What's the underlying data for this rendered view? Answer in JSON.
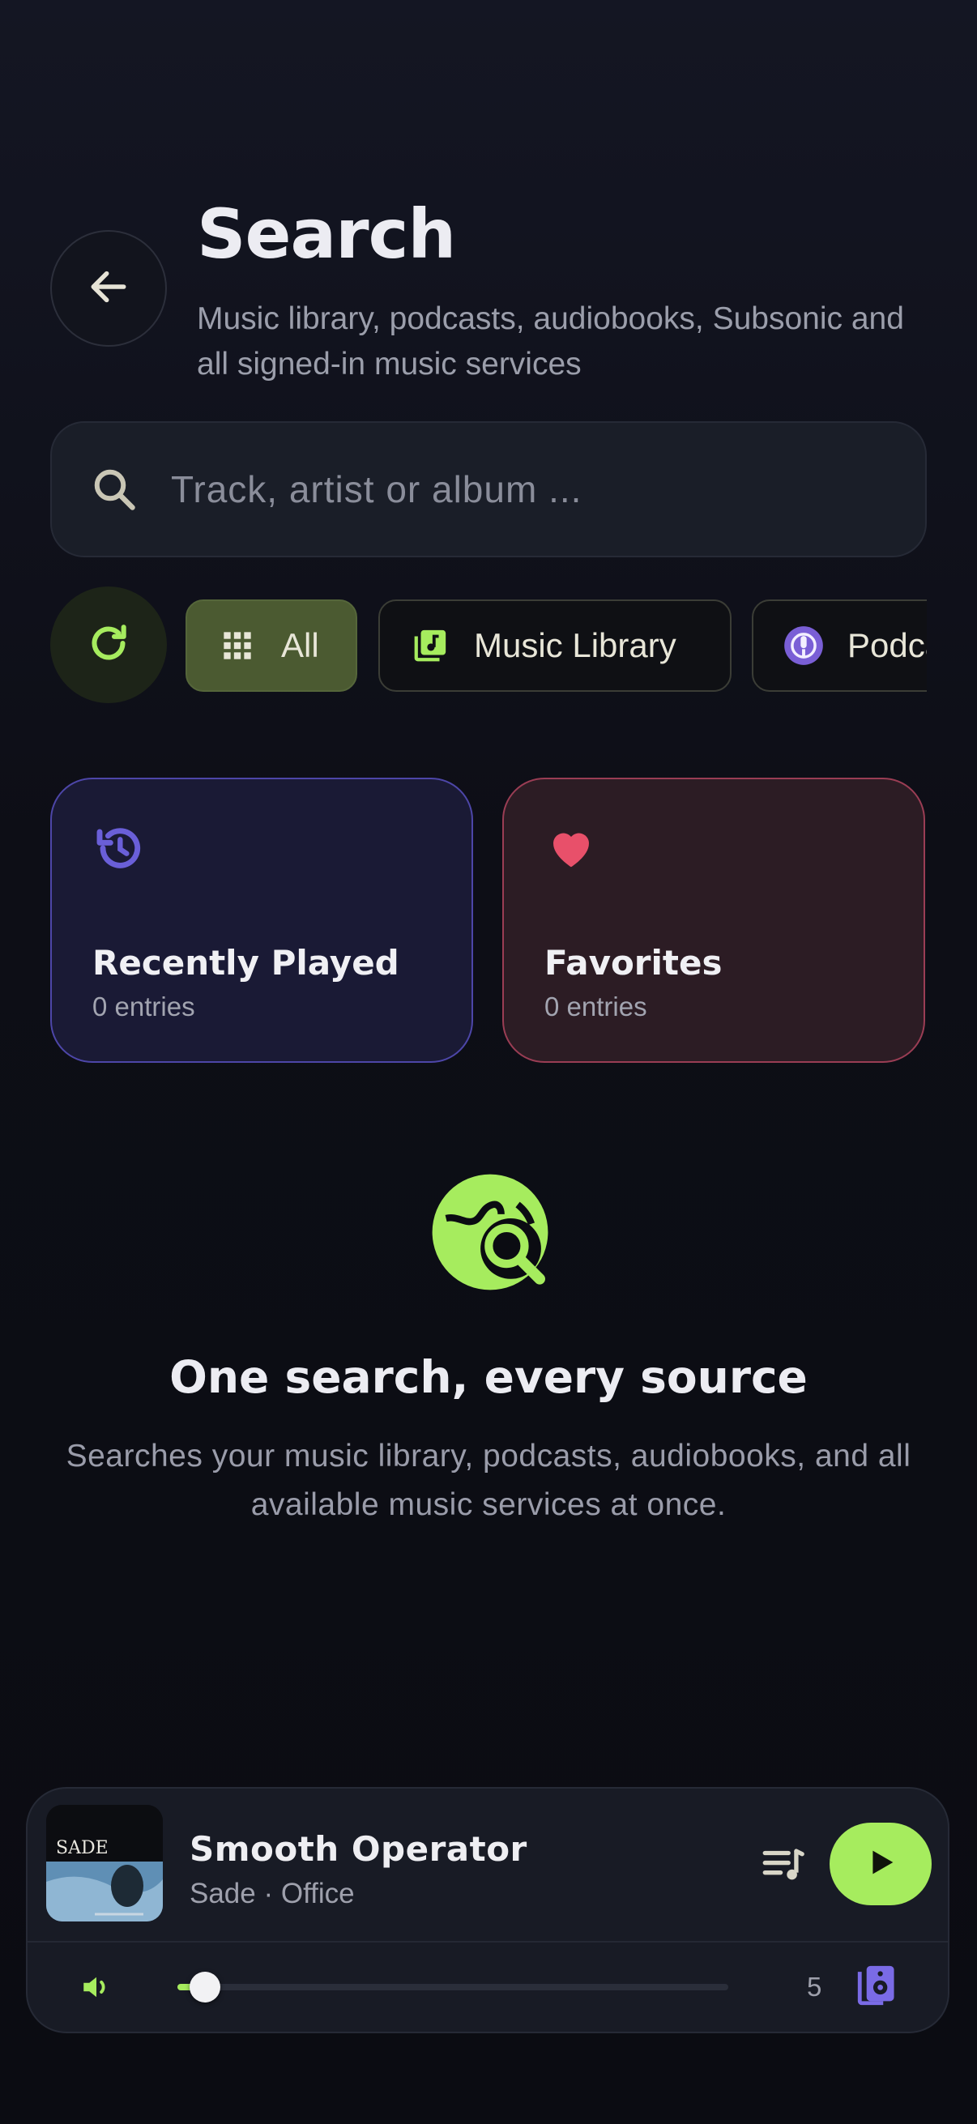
{
  "header": {
    "title": "Search",
    "subtitle": "Music library, podcasts, audiobooks, Subsonic and all signed-in music services",
    "back_icon": "arrow-left-icon"
  },
  "search": {
    "placeholder": "Track, artist or album ...",
    "value": "",
    "icon": "search-icon"
  },
  "filters": {
    "refresh_icon": "refresh-icon",
    "chips": [
      {
        "label": "All",
        "icon": "grid-icon",
        "selected": true
      },
      {
        "label": "Music Library",
        "icon": "music-library-icon",
        "selected": false
      },
      {
        "label": "Podcasts",
        "icon": "podcast-icon",
        "selected": false
      }
    ]
  },
  "cards": {
    "recent": {
      "title": "Recently Played",
      "count": "0 entries",
      "icon": "history-icon",
      "accent": "#6a5fd8"
    },
    "favorites": {
      "title": "Favorites",
      "count": "0 entries",
      "icon": "heart-icon",
      "accent": "#e8506a"
    }
  },
  "empty_state": {
    "icon": "globe-search-icon",
    "title": "One search, every source",
    "description": "Searches your music library, podcasts, audiobooks, and all available music services at once."
  },
  "player": {
    "track_title": "Smooth Operator",
    "track_subtitle": "Sade · Office",
    "album_art_text": "SADE",
    "volume_level": 0.05,
    "speaker_count": "5",
    "accent": "#a6ec5e"
  }
}
